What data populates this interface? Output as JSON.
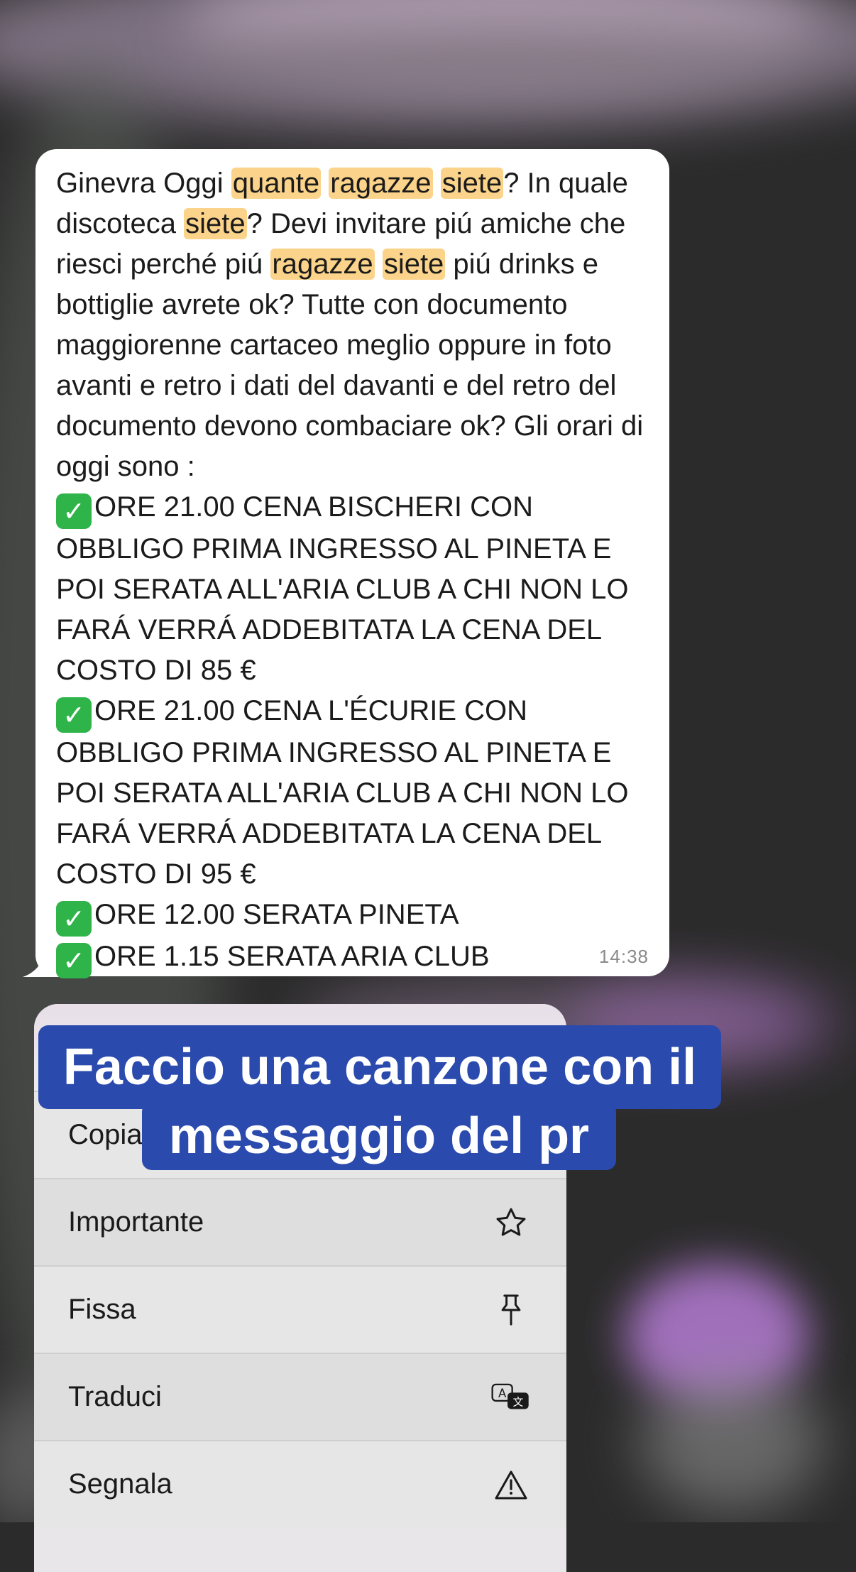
{
  "message": {
    "parts": [
      {
        "t": "Ginevra Oggi "
      },
      {
        "t": "quante",
        "hl": true
      },
      {
        "t": " "
      },
      {
        "t": "ragazze",
        "hl": true
      },
      {
        "t": " "
      },
      {
        "t": "siete",
        "hl": true
      },
      {
        "t": "? In quale discoteca "
      },
      {
        "t": "siete",
        "hl": true
      },
      {
        "t": "? Devi invitare piú amiche che riesci perché piú "
      },
      {
        "t": "ragazze",
        "hl": true
      },
      {
        "t": " "
      },
      {
        "t": "siete",
        "hl": true
      },
      {
        "t": " piú drinks e bottiglie avrete ok? Tutte con documento maggiorenne cartaceo meglio oppure in foto avanti e retro i dati del davanti e del retro del documento devono combaciare ok? Gli orari di oggi sono :"
      }
    ],
    "items": [
      "ORE 21.00 CENA BISCHERI CON OBBLIGO PRIMA INGRESSO AL PINETA E POI SERATA ALL'ARIA CLUB A CHI NON LO FARÁ VERRÁ ADDEBITATA LA CENA DEL COSTO DI 85 €",
      "ORE 21.00 CENA L'ÉCURIE CON OBBLIGO PRIMA INGRESSO AL PINETA E POI SERATA ALL'ARIA CLUB A CHI NON LO FARÁ VERRÁ ADDEBITATA LA CENA DEL COSTO DI 95 €",
      "ORE 12.00 SERATA PINETA",
      "ORE 1.15 SERATA ARIA CLUB"
    ],
    "check_glyph": "✓",
    "time": "14:38"
  },
  "menu": {
    "items": [
      {
        "label": "Copia",
        "icon": "copy-icon"
      },
      {
        "label": "Importante",
        "icon": "star-icon"
      },
      {
        "label": "Fissa",
        "icon": "pin-icon"
      },
      {
        "label": "Traduci",
        "icon": "translate-icon"
      },
      {
        "label": "Segnala",
        "icon": "warning-icon"
      }
    ]
  },
  "caption": {
    "line1": "Faccio una canzone con il",
    "line2": "messaggio del pr"
  },
  "colors": {
    "highlight": "#fbd38a",
    "check": "#2fb44a",
    "caption_bg": "#2a4aad"
  }
}
